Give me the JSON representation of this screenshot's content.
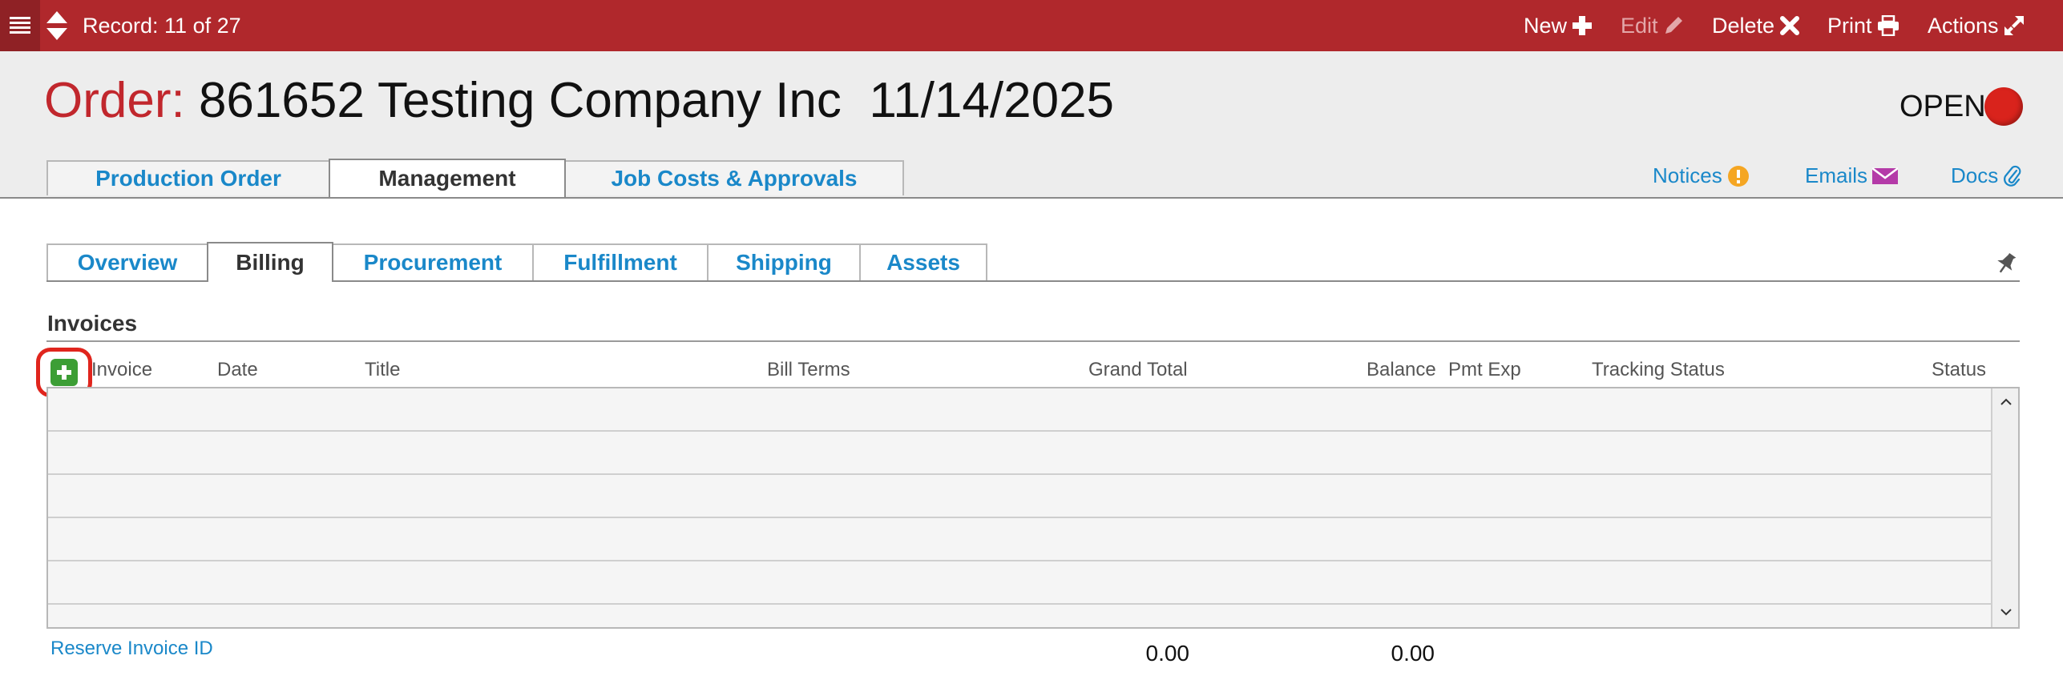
{
  "topbar": {
    "record_label": "Record: 11 of 27",
    "actions": {
      "new": "New",
      "edit": "Edit",
      "delete": "Delete",
      "print": "Print",
      "actions": "Actions"
    },
    "icons": [
      "menu-icon",
      "sort-up-down-icon",
      "plus-icon",
      "pencil-icon",
      "x-icon",
      "printer-icon",
      "expand-arrows-icon"
    ]
  },
  "header": {
    "title_label": "Order:",
    "title_text": " 861652 Testing Company Inc  11/14/2025",
    "status": "OPEN",
    "status_color": "#d9231c",
    "tabs": [
      {
        "label": "Production Order"
      },
      {
        "label": "Management"
      },
      {
        "label": "Job Costs & Approvals"
      }
    ],
    "active_tab": "Management",
    "links": {
      "notices": "Notices",
      "emails": "Emails",
      "docs": "Docs"
    }
  },
  "subtabs": [
    {
      "label": "Overview"
    },
    {
      "label": "Billing"
    },
    {
      "label": "Procurement"
    },
    {
      "label": "Fulfillment"
    },
    {
      "label": "Shipping"
    },
    {
      "label": "Assets"
    }
  ],
  "active_subtab": "Billing",
  "invoices": {
    "title": "Invoices",
    "columns": [
      "Invoice",
      "Date",
      "Title",
      "Bill Terms",
      "Grand Total",
      "Balance",
      "Pmt Exp",
      "Tracking Status",
      "Status"
    ],
    "rows": [],
    "reserve_link": "Reserve Invoice ID",
    "grand_total_sum": "0.00",
    "balance_sum": "0.00"
  },
  "colors": {
    "brand_red": "#b0282c",
    "link_blue": "#1a88c9",
    "add_green": "#3c9e35",
    "highlight_red": "#e0251d"
  }
}
